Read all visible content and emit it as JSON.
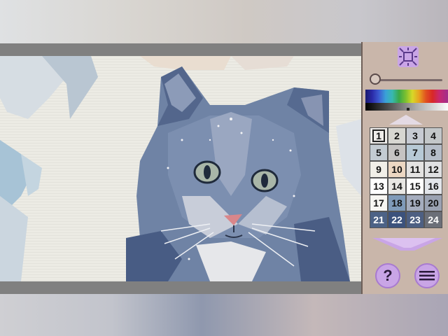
{
  "panel": {
    "fit_icon": "fit-to-screen-icon",
    "zoom_level": 0,
    "help_label": "?",
    "menu_icon": "menu-icon"
  },
  "colors": {
    "accent": "#c9a5e6",
    "panel_bg": "#c9b6aa",
    "frame": "#808080"
  },
  "palette_cells": [
    {
      "n": "1",
      "color": "#eeecea"
    },
    {
      "n": "2",
      "color": "#d7d6d1"
    },
    {
      "n": "3",
      "color": "#c7cbd3"
    },
    {
      "n": "4",
      "color": "#c3c7c9"
    },
    {
      "n": "5",
      "color": "#c3cbd2"
    },
    {
      "n": "6",
      "color": "#c5c3c2"
    },
    {
      "n": "7",
      "color": "#b7c9d6"
    },
    {
      "n": "8",
      "color": "#b5bdc8"
    },
    {
      "n": "9",
      "color": "#f1efe8"
    },
    {
      "n": "10",
      "color": "#ecd7c2"
    },
    {
      "n": "11",
      "color": "#e4e3e2"
    },
    {
      "n": "12",
      "color": "#dfe0e2"
    },
    {
      "n": "13",
      "color": "#fefefe"
    },
    {
      "n": "14",
      "color": "#e8e7e4"
    },
    {
      "n": "15",
      "color": "#ffffff"
    },
    {
      "n": "16",
      "color": "#e2e5ea"
    },
    {
      "n": "17",
      "color": "#f7f6f2"
    },
    {
      "n": "18",
      "color": "#7f9ab9"
    },
    {
      "n": "19",
      "color": "#a5adbe"
    },
    {
      "n": "20",
      "color": "#9aa2b2"
    },
    {
      "n": "21",
      "color": "#4c6286"
    },
    {
      "n": "22",
      "color": "#3c527c"
    },
    {
      "n": "23",
      "color": "#4d5f82"
    },
    {
      "n": "24",
      "color": "#6b6f78"
    }
  ],
  "selected_cell": "1"
}
